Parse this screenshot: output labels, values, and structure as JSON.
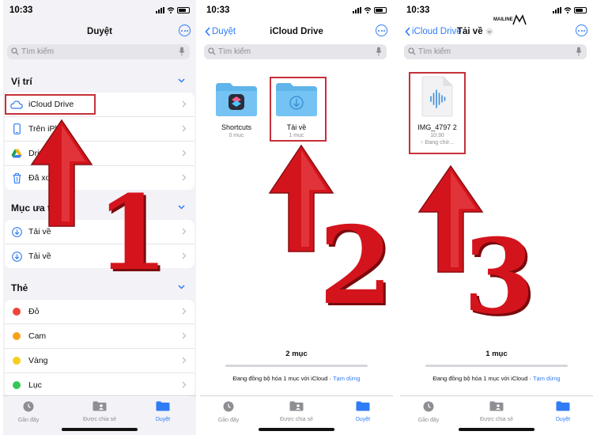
{
  "status": {
    "time": "10:33"
  },
  "panel1": {
    "title": "Duyệt",
    "search_placeholder": "Tìm kiếm",
    "locations_header": "Vị trí",
    "locations": [
      {
        "label": "iCloud Drive",
        "icon": "cloud-icon"
      },
      {
        "label": "Trên iPho",
        "icon": "phone-icon"
      },
      {
        "label": "Drive",
        "icon": "google-drive-icon"
      },
      {
        "label": "Đã xoá",
        "icon": "trash-icon"
      }
    ],
    "favorites_header": "Mục ưa th",
    "favorites": [
      {
        "label": "Tải về",
        "icon": "download-icon"
      },
      {
        "label": "Tải về",
        "icon": "download-icon"
      }
    ],
    "tags_header": "Thẻ",
    "tags": [
      {
        "label": "Đỏ",
        "color": "#f0443a"
      },
      {
        "label": "Cam",
        "color": "#f7a21b"
      },
      {
        "label": "Vàng",
        "color": "#f5cf1d"
      },
      {
        "label": "Lục",
        "color": "#35c759"
      }
    ],
    "big_number": "1"
  },
  "panel2": {
    "back": "Duyệt",
    "title": "iCloud Drive",
    "search_placeholder": "Tìm kiếm",
    "folders": [
      {
        "name": "Shortcuts",
        "sub": "0 mục"
      },
      {
        "name": "Tải về",
        "sub": "1 mục"
      }
    ],
    "count": "2 mục",
    "sync_text": "Đang đồng bộ hóa 1 mục với iCloud",
    "sync_sep": " · ",
    "pause": "Tạm dừng",
    "big_number": "2"
  },
  "panel3": {
    "back": "iCloud Drive",
    "title": "Tải về",
    "brand": "MAILINE",
    "search_placeholder": "Tìm kiếm",
    "file": {
      "name": "IMG_4797 2",
      "time": "10:30",
      "status": "↑ Đang chờ..."
    },
    "count": "1 mục",
    "sync_text": "Đang đồng bộ hóa 1 mục với iCloud",
    "sync_sep": " · ",
    "pause": "Tạm dừng",
    "big_number": "3"
  },
  "tabs": {
    "recent": "Gần đây",
    "shared": "Được chia sẻ",
    "browse": "Duyệt"
  },
  "colors": {
    "accent": "#2f7cf6",
    "highlight": "#c6303a",
    "arrow": "#d4141c"
  }
}
